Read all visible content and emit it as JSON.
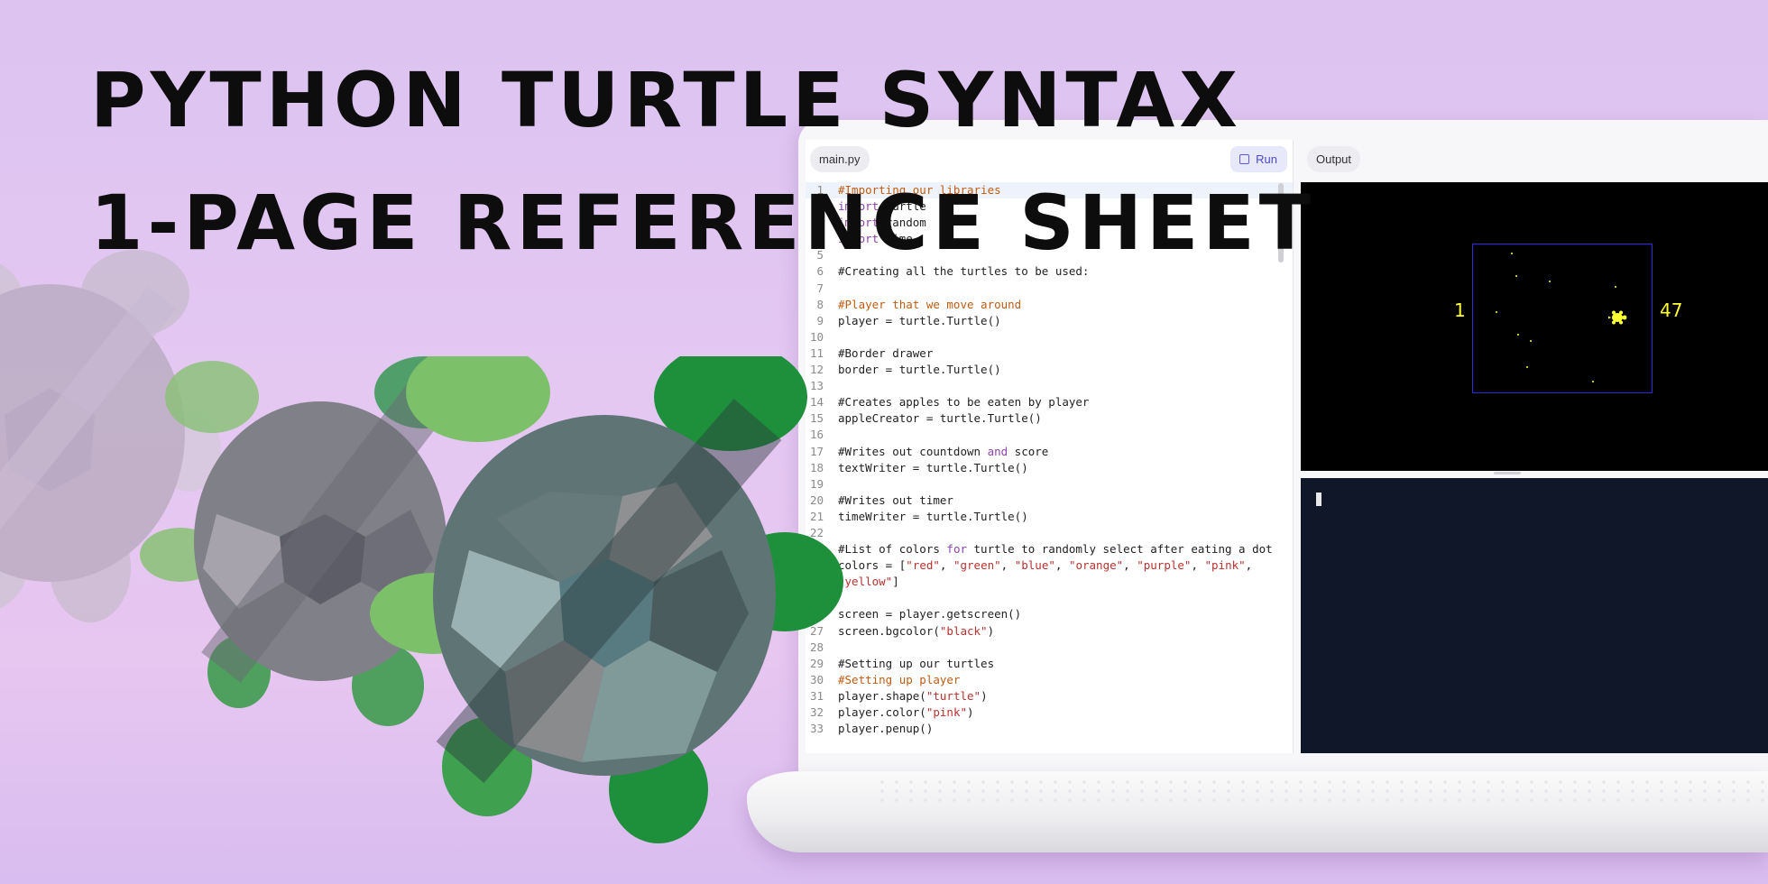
{
  "headline": {
    "line1": "Python Turtle Syntax",
    "line2": "1-Page Reference Sheet"
  },
  "editor": {
    "tab_label": "main.py",
    "run_label": "Run",
    "run_icon": "stop-square-icon",
    "lines": [
      {
        "n": "1",
        "html": "<span class='tok-cmt'>#Importing our libraries</span>"
      },
      {
        "n": "2",
        "html": "<span class='tok-kw'>import</span> turtle"
      },
      {
        "n": "3",
        "html": "<span class='tok-kw'>import</span> random"
      },
      {
        "n": "4",
        "html": "<span class='tok-kw'>import</span> time"
      },
      {
        "n": "5",
        "html": ""
      },
      {
        "n": "6",
        "html": "#Creating all the turtles to be used:"
      },
      {
        "n": "7",
        "html": ""
      },
      {
        "n": "8",
        "html": "<span class='tok-cmt'>#Player that we move around</span>"
      },
      {
        "n": "9",
        "html": "player = turtle.Turtle()"
      },
      {
        "n": "10",
        "html": ""
      },
      {
        "n": "11",
        "html": "#Border drawer"
      },
      {
        "n": "12",
        "html": "border = turtle.Turtle()"
      },
      {
        "n": "13",
        "html": ""
      },
      {
        "n": "14",
        "html": "#Creates apples to be eaten by player"
      },
      {
        "n": "15",
        "html": "appleCreator = turtle.Turtle()"
      },
      {
        "n": "16",
        "html": ""
      },
      {
        "n": "17",
        "html": "#Writes out countdown <span class='tok-kw'>and</span> score"
      },
      {
        "n": "18",
        "html": "textWriter = turtle.Turtle()"
      },
      {
        "n": "19",
        "html": ""
      },
      {
        "n": "20",
        "html": "#Writes out timer"
      },
      {
        "n": "21",
        "html": "timeWriter = turtle.Turtle()"
      },
      {
        "n": "22",
        "html": ""
      },
      {
        "n": "23",
        "html": "#List of colors <span class='tok-kw'>for</span> turtle to randomly select after eating a dot"
      },
      {
        "n": "24",
        "html": "colors = [<span class='tok-str'>\"red\"</span>, <span class='tok-str'>\"green\"</span>, <span class='tok-str'>\"blue\"</span>, <span class='tok-str'>\"orange\"</span>, <span class='tok-str'>\"purple\"</span>, <span class='tok-str'>\"pink\"</span>,"
      },
      {
        "n": "",
        "html": "<span class='tok-str'>\"yellow\"</span>]"
      },
      {
        "n": "",
        "html": ""
      },
      {
        "n": "26",
        "html": "screen = player.getscreen()"
      },
      {
        "n": "27",
        "html": "screen.bgcolor(<span class='tok-str'>\"black\"</span>)"
      },
      {
        "n": "28",
        "html": ""
      },
      {
        "n": "29",
        "html": "#Setting up our turtles"
      },
      {
        "n": "30",
        "html": "<span class='tok-cmt'>#Setting up player</span>"
      },
      {
        "n": "31",
        "html": "player.shape(<span class='tok-str'>\"turtle\"</span>)"
      },
      {
        "n": "32",
        "html": "player.color(<span class='tok-str'>\"pink\"</span>)"
      },
      {
        "n": "33",
        "html": "player.penup()"
      }
    ]
  },
  "output": {
    "tab_label": "Output",
    "score_left": "1",
    "score_right": "47",
    "player_icon": "turtle-icon",
    "accent_yellow": "#ffff33",
    "border_blue": "#2b2bd8"
  },
  "colors": {
    "shell_dark": "#3a4a4e",
    "leg_green": "#1e8f3a"
  }
}
